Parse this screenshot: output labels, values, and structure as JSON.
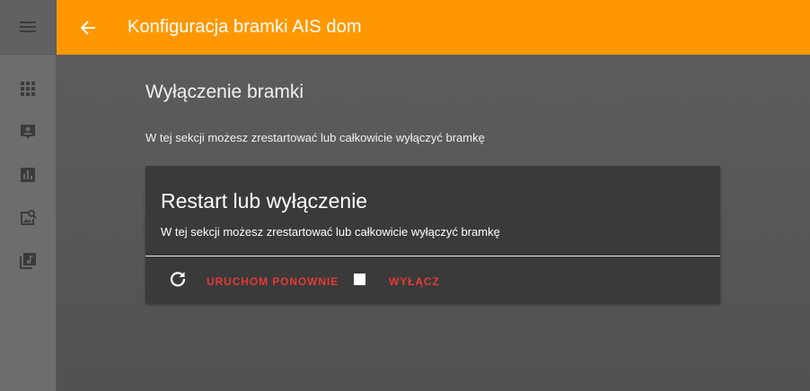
{
  "topbar": {
    "title": "Konfiguracja bramki AIS dom",
    "color": "#ff9800"
  },
  "sidebar": {
    "menu_icon": "menu-icon",
    "items": [
      {
        "icon": "apps-grid-icon"
      },
      {
        "icon": "person-card-icon"
      },
      {
        "icon": "bar-chart-icon"
      },
      {
        "icon": "image-search-icon"
      },
      {
        "icon": "music-library-icon"
      }
    ]
  },
  "section": {
    "title": "Wyłączenie bramki",
    "description": "W tej sekcji możesz zrestartować lub całkowicie wyłączyć bramkę"
  },
  "card": {
    "title": "Restart lub wyłączenie",
    "description": "W tej sekcji możesz zrestartować lub całkowicie wyłączyć bramkę",
    "restart_label": "URUCHOM PONOWNIE",
    "poweroff_label": "WYŁĄCZ",
    "action_color": "#e53935"
  }
}
